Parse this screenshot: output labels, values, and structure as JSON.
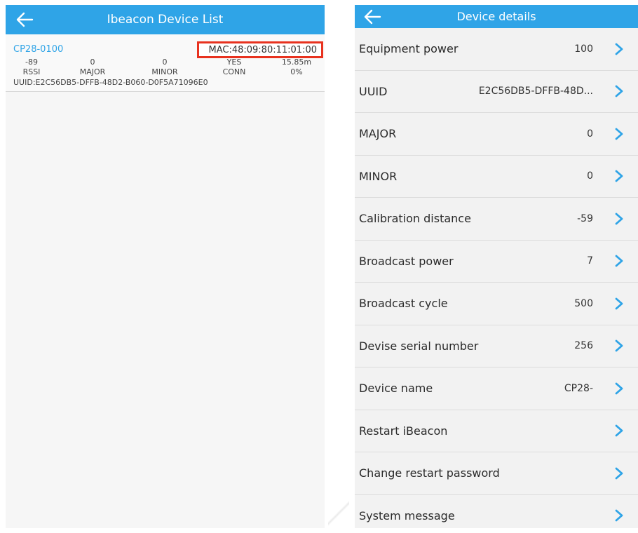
{
  "left_screen": {
    "header": {
      "title": "Ibeacon Device List"
    },
    "device": {
      "name": "CP28-0100",
      "mac": "MAC:48:09:80:11:01:00",
      "values": [
        "-89",
        "0",
        "0",
        "YES",
        "15.85m"
      ],
      "labels": [
        "RSSI",
        "MAJOR",
        "MINOR",
        "CONN",
        "0%"
      ],
      "uuid": "UUID:E2C56DB5-DFFB-48D2-B060-D0F5A71096E0"
    },
    "colors": {
      "accent": "#2fa4e7",
      "highlight_box": "#e8321f"
    }
  },
  "right_screen": {
    "header": {
      "title": "Device details"
    },
    "rows": [
      {
        "label": "Equipment power",
        "value": "100"
      },
      {
        "label": "UUID",
        "value": "E2C56DB5-DFFB-48D..."
      },
      {
        "label": "MAJOR",
        "value": "0"
      },
      {
        "label": "MINOR",
        "value": "0"
      },
      {
        "label": "Calibration distance",
        "value": "-59"
      },
      {
        "label": "Broadcast power",
        "value": "7"
      },
      {
        "label": "Broadcast cycle",
        "value": "500"
      },
      {
        "label": "Devise serial number",
        "value": "256"
      },
      {
        "label": "Device name",
        "value": "CP28-"
      },
      {
        "label": "Restart iBeacon",
        "value": ""
      },
      {
        "label": "Change restart password",
        "value": ""
      },
      {
        "label": "System message",
        "value": ""
      }
    ]
  },
  "icons": {
    "back": "arrow-left-icon",
    "row_action": "chevron-right-icon"
  }
}
